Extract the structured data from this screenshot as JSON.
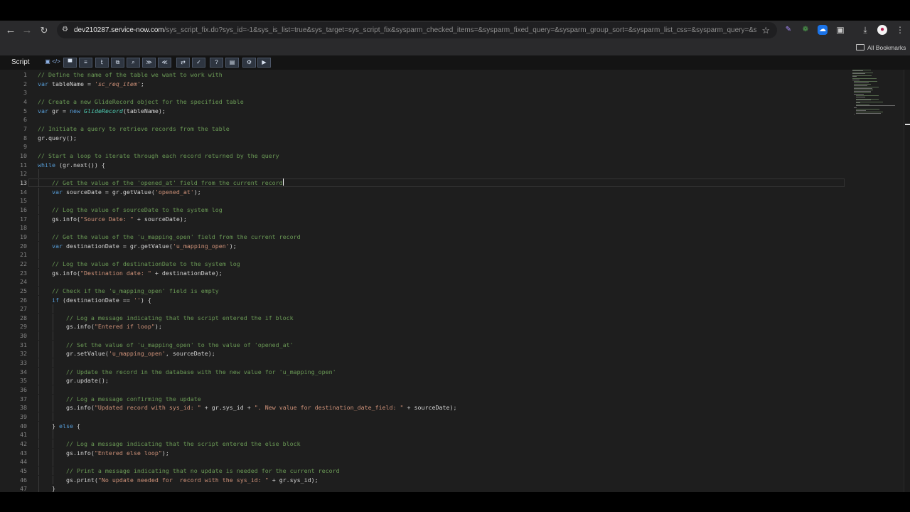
{
  "browser": {
    "back_icon": "arrow-left-icon",
    "forward_icon": "arrow-right-icon",
    "reload_icon": "reload-icon",
    "url_host": "dev210287.service-now.com",
    "url_path": "/sys_script_fix.do?sys_id=-1&sys_is_list=true&sys_target=sys_script_fix&sysparm_checked_items=&sysparm_fixed_query=&sysparm_group_sort=&sysparm_list_css=&sysparm_query=&sysparm_referring_...",
    "bookmark_star_icon": "star-icon",
    "extensions": [
      "pen-extension-icon",
      "gear-extension-icon",
      "cloud-extension-icon",
      "puzzle-extension-icon"
    ],
    "download_icon": "download-icon",
    "profile_icon": "profile-avatar-icon",
    "menu_icon": "kebab-menu-icon",
    "all_bookmarks": "All Bookmarks"
  },
  "page": {
    "field_label": "Script"
  },
  "editor": {
    "toolbar_icons": [
      "save-icon",
      "code-toggle-icon",
      "comment-icon",
      "format-icon",
      "script-include-icon",
      "fullscreen-icon",
      "search-icon",
      "find-next-icon",
      "find-prev-icon",
      "replace-icon",
      "syntax-check-icon",
      "help-icon",
      "doc-icon",
      "script-debugger-icon",
      "run-icon"
    ],
    "toolbar_glyphs": [
      "▣",
      "</>",
      "▀",
      "≡",
      "ﾋ",
      "⧉",
      "⌕",
      "≫",
      "≪",
      "⇄",
      "✓",
      "?",
      "▤",
      "⚙",
      "▶"
    ],
    "current_line": 13,
    "lines": [
      {
        "n": "1",
        "code": "// Define the name of the table we want to work with"
      },
      {
        "n": "2",
        "code": "var tableName = 'sc_req_item';"
      },
      {
        "n": "3",
        "code": ""
      },
      {
        "n": "4",
        "code": "// Create a new GlideRecord object for the specified table"
      },
      {
        "n": "5",
        "code": "var gr = new GlideRecord(tableName);"
      },
      {
        "n": "6",
        "code": ""
      },
      {
        "n": "7",
        "code": "// Initiate a query to retrieve records from the table"
      },
      {
        "n": "8",
        "code": "gr.query();"
      },
      {
        "n": "9",
        "code": ""
      },
      {
        "n": "10",
        "code": "// Start a loop to iterate through each record returned by the query"
      },
      {
        "n": "11",
        "code": "while (gr.next()) {"
      },
      {
        "n": "12",
        "code": ""
      },
      {
        "n": "13",
        "code": "    // Get the value of the 'opened_at' field from the current record"
      },
      {
        "n": "14",
        "code": "    var sourceDate = gr.getValue('opened_at');"
      },
      {
        "n": "15",
        "code": ""
      },
      {
        "n": "16",
        "code": "    // Log the value of sourceDate to the system log"
      },
      {
        "n": "17",
        "code": "    gs.info(\"Source Date: \" + sourceDate);"
      },
      {
        "n": "18",
        "code": ""
      },
      {
        "n": "19",
        "code": "    // Get the value of the 'u_mapping_open' field from the current record"
      },
      {
        "n": "20",
        "code": "    var destinationDate = gr.getValue('u_mapping_open');"
      },
      {
        "n": "21",
        "code": ""
      },
      {
        "n": "22",
        "code": "    // Log the value of destinationDate to the system log"
      },
      {
        "n": "23",
        "code": "    gs.info(\"Destination date: \" + destinationDate);"
      },
      {
        "n": "24",
        "code": ""
      },
      {
        "n": "25",
        "code": "    // Check if the 'u_mapping_open' field is empty"
      },
      {
        "n": "26",
        "code": "    if (destinationDate == '') {"
      },
      {
        "n": "27",
        "code": ""
      },
      {
        "n": "28",
        "code": "        // Log a message indicating that the script entered the if block"
      },
      {
        "n": "29",
        "code": "        gs.info(\"Entered if loop\");"
      },
      {
        "n": "30",
        "code": ""
      },
      {
        "n": "31",
        "code": "        // Set the value of 'u_mapping_open' to the value of 'opened_at'"
      },
      {
        "n": "32",
        "code": "        gr.setValue('u_mapping_open', sourceDate);"
      },
      {
        "n": "33",
        "code": ""
      },
      {
        "n": "34",
        "code": "        // Update the record in the database with the new value for 'u_mapping_open'"
      },
      {
        "n": "35",
        "code": "        gr.update();"
      },
      {
        "n": "36",
        "code": ""
      },
      {
        "n": "37",
        "code": "        // Log a message confirming the update"
      },
      {
        "n": "38",
        "code": "        gs.info(\"Updated record with sys_id: \" + gr.sys_id + \". New value for destination_date_field: \" + sourceDate);"
      },
      {
        "n": "39",
        "code": ""
      },
      {
        "n": "40",
        "code": "    } else {"
      },
      {
        "n": "41",
        "code": ""
      },
      {
        "n": "42",
        "code": "        // Log a message indicating that the script entered the else block"
      },
      {
        "n": "43",
        "code": "        gs.info(\"Entered else loop\");"
      },
      {
        "n": "44",
        "code": ""
      },
      {
        "n": "45",
        "code": "        // Print a message indicating that no update is needed for the current record"
      },
      {
        "n": "46",
        "code": "        gs.print(\"No update needed for  record with the sys_id: \" + gr.sys_id);"
      },
      {
        "n": "47",
        "code": "    }"
      }
    ]
  }
}
